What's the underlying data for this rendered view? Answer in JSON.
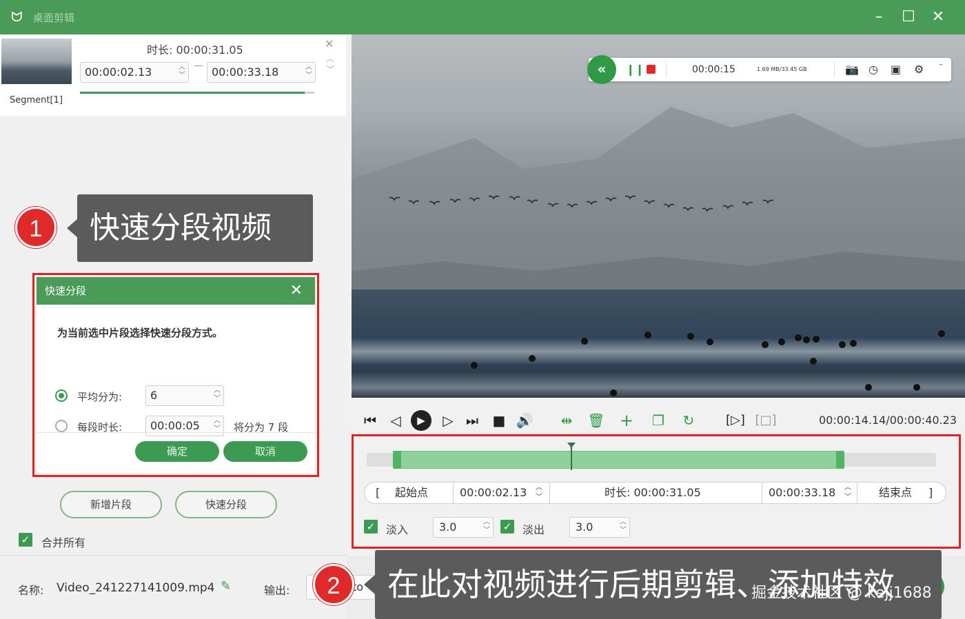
{
  "app": {
    "title": "桌面剪辑"
  },
  "segment": {
    "name": "Segment[1]",
    "duration_label": "时长:  00:00:31.05",
    "start": "00:00:02.13",
    "end": "00:00:33.18",
    "progress": 0.96
  },
  "callout1": {
    "number": "1",
    "text": "快速分段视频"
  },
  "dialog": {
    "title": "快速分段",
    "description": "为当前选中片段选择快速分段方式。",
    "option_equal_label": "平均分为:",
    "option_equal_value": "6",
    "option_duration_label": "每段时长:",
    "option_duration_value": "00:00:05",
    "result_text": "将分为 7 段",
    "ok_label": "确定",
    "cancel_label": "取消"
  },
  "left_actions": {
    "add_segment": "新增片段",
    "quick_split": "快速分段",
    "merge_all": "合并所有"
  },
  "bottom": {
    "name_label": "名称:",
    "file_name": "Video_241227141009.mp4",
    "output_label": "输出:",
    "output_value": "to"
  },
  "recorder": {
    "time": "00:00:15",
    "size": "1.69 MB/33.45 GB"
  },
  "player": {
    "time": "00:00:14.14/00:00:40.23",
    "playhead_fraction": 0.36,
    "selection_start_fraction": 0.053,
    "selection_end_fraction": 0.832
  },
  "trim": {
    "start_label": "起始点",
    "start_value": "00:00:02.13",
    "duration_label": "时长:  00:00:31.05",
    "end_value": "00:00:33.18",
    "end_label": "结束点",
    "bracket_open": "[",
    "bracket_close": "]"
  },
  "fade": {
    "fade_in_label": "淡入",
    "fade_in_value": "3.0",
    "fade_out_label": "淡出",
    "fade_out_value": "3.0"
  },
  "callout2": {
    "number": "2",
    "text": "在此对视频进行后期剪辑、添加特效"
  },
  "watermark": "掘金技术社区 @ kejj1688",
  "colors": {
    "brand_green": "#4a9a58",
    "accent_green": "#2f9b45",
    "highlight_red": "#e02222",
    "callout_gray": "#5b5b5b"
  }
}
